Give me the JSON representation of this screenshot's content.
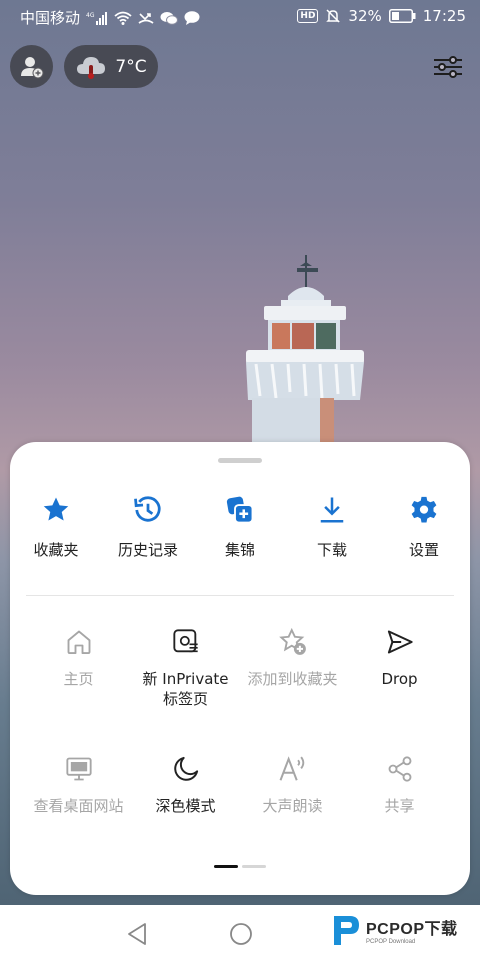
{
  "status_bar": {
    "carrier": "中国移动",
    "network": "4G",
    "battery": "32%",
    "time": "17:25",
    "hd": "HD"
  },
  "top": {
    "temperature": "7°C"
  },
  "menu": {
    "row1": [
      {
        "label": "收藏夹",
        "icon": "star-icon"
      },
      {
        "label": "历史记录",
        "icon": "history-icon"
      },
      {
        "label": "集锦",
        "icon": "collections-icon"
      },
      {
        "label": "下载",
        "icon": "download-icon"
      },
      {
        "label": "设置",
        "icon": "gear-icon"
      }
    ],
    "row2": [
      {
        "label": "主页",
        "icon": "home-icon",
        "enabled": false
      },
      {
        "label": "新 InPrivate",
        "label2": "标签页",
        "icon": "inprivate-tab-icon",
        "enabled": true
      },
      {
        "label": "添加到收藏夹",
        "icon": "add-favorite-icon",
        "enabled": false
      },
      {
        "label": "Drop",
        "icon": "send-icon",
        "enabled": true
      }
    ],
    "row3": [
      {
        "label": "查看桌面网站",
        "icon": "desktop-icon",
        "enabled": false
      },
      {
        "label": "深色模式",
        "icon": "moon-icon",
        "enabled": true
      },
      {
        "label": "大声朗读",
        "icon": "read-aloud-icon",
        "enabled": false
      },
      {
        "label": "共享",
        "icon": "share-icon",
        "enabled": false
      }
    ],
    "page": 1,
    "pages": 2
  },
  "watermark": {
    "brand": "PCPOP下载",
    "sub": "PCPOP Download"
  },
  "colors": {
    "accent": "#1a73d0",
    "dim": "#a6a6a6",
    "text": "#222222"
  }
}
